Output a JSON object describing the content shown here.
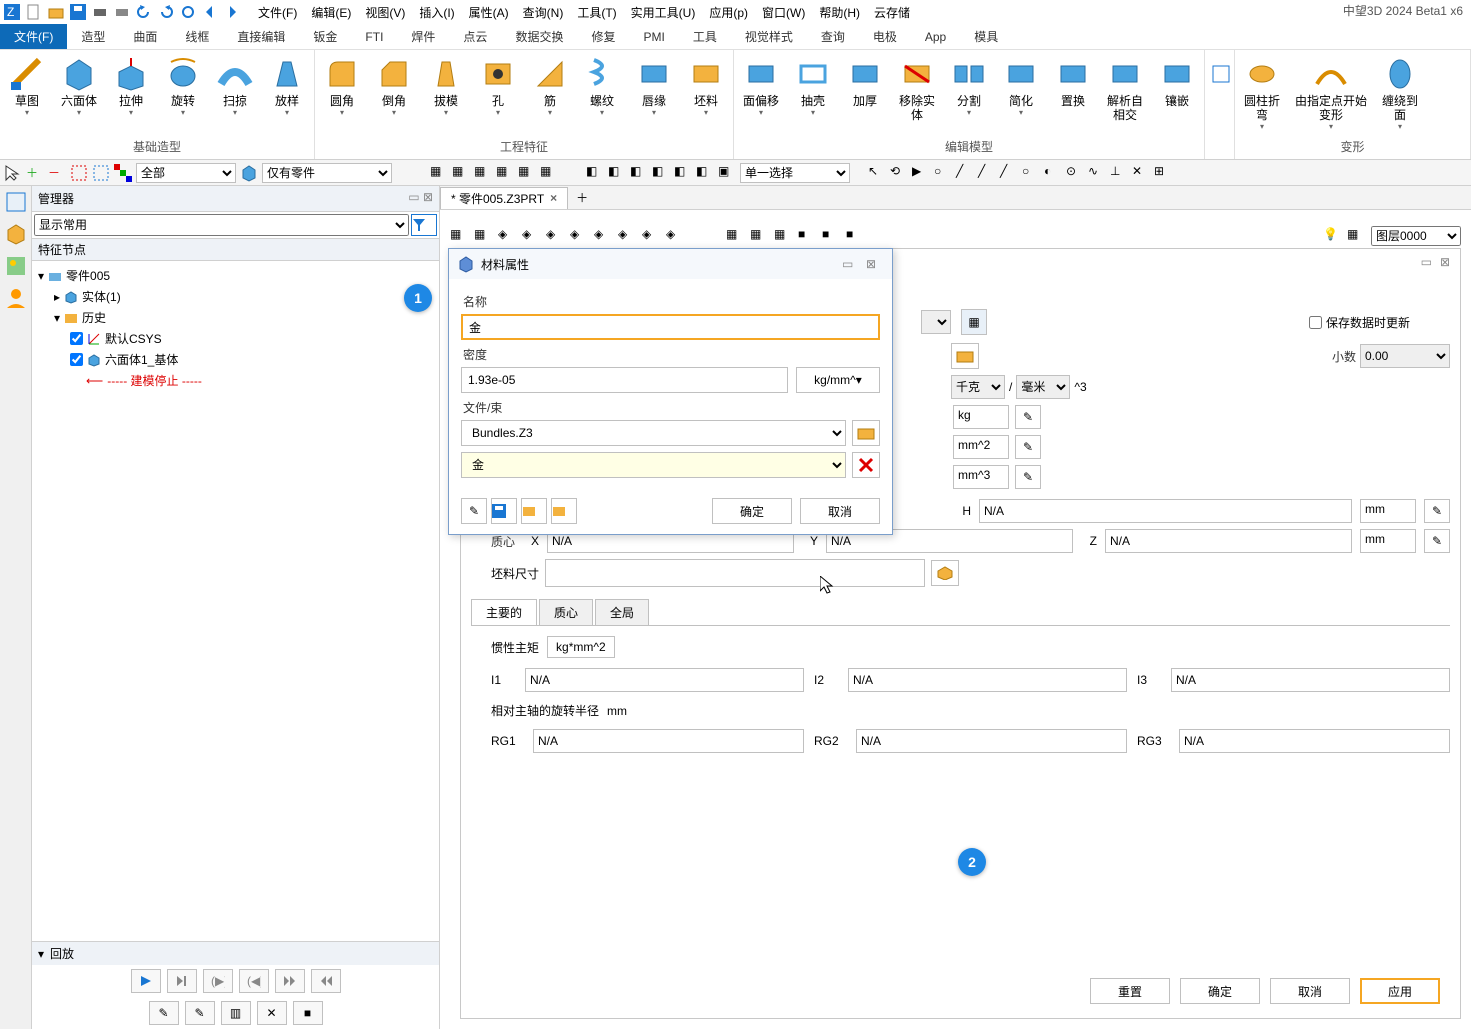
{
  "app_title": "中望3D 2024 Beta1 x6",
  "menus": [
    "文件(F)",
    "编辑(E)",
    "视图(V)",
    "插入(I)",
    "属性(A)",
    "查询(N)",
    "工具(T)",
    "实用工具(U)",
    "应用(p)",
    "窗口(W)",
    "帮助(H)",
    "云存储"
  ],
  "ribbon_tabs": [
    "文件(F)",
    "造型",
    "曲面",
    "线框",
    "直接编辑",
    "钣金",
    "FTI",
    "焊件",
    "点云",
    "数据交换",
    "修复",
    "PMI",
    "工具",
    "视觉样式",
    "查询",
    "电极",
    "App",
    "模具"
  ],
  "ribbon_active_tab": "造型",
  "ribbon_groups": {
    "base": {
      "label": "基础造型",
      "items": [
        "草图",
        "六面体",
        "拉伸",
        "旋转",
        "扫掠",
        "放样"
      ]
    },
    "feature": {
      "label": "工程特征",
      "items": [
        "圆角",
        "倒角",
        "拔模",
        "孔",
        "筋",
        "螺纹",
        "唇缘",
        "坯料"
      ]
    },
    "edit": {
      "label": "编辑模型",
      "items": [
        "面偏移",
        "抽壳",
        "加厚",
        "移除实体",
        "分割",
        "简化",
        "置换",
        "解析自相交",
        "镶嵌"
      ]
    },
    "deform_anchor": {
      "label": "",
      "items": [
        ""
      ]
    },
    "deform": {
      "label": "变形",
      "items": [
        "圆柱折弯",
        "由指定点开始变形",
        "缠绕到面"
      ]
    }
  },
  "filter_bar": {
    "all": "全部",
    "parts_only": "仅有零件",
    "select_mode": "单一选择"
  },
  "doc_tab": {
    "name": "* 零件005.Z3PRT"
  },
  "manager": {
    "title": "管理器",
    "filter": "显示常用",
    "tree_header": "特征节点",
    "root": "零件005",
    "entity": "实体(1)",
    "history": "历史",
    "csys": "默认CSYS",
    "box": "六面体1_基体",
    "stop": "----- 建模停止 -----",
    "playback": "回放"
  },
  "modal": {
    "title": "材料属性",
    "name_label": "名称",
    "name_value": "金",
    "density_label": "密度",
    "density_value": "1.93e-05",
    "density_unit": "kg/mm^",
    "file_label": "文件/束",
    "file_value": "Bundles.Z3",
    "material_value": "金",
    "ok": "确定",
    "cancel": "取消"
  },
  "right_panel": {
    "save_data": "保存数据时更新",
    "decimal_label": "小数",
    "decimal_value": "0.00",
    "mass_unit": "千克",
    "length_unit": "毫米",
    "cube": "^3",
    "kg": "kg",
    "mm2": "mm^2",
    "mm3": "mm^3",
    "H": "H",
    "mm": "mm",
    "NA": "N/A",
    "centroid_label": "质心",
    "X": "X",
    "Y": "Y",
    "Z": "Z",
    "stock_label": "坯料尺寸",
    "tabs": [
      "主要的",
      "质心",
      "全局"
    ],
    "inertia_label": "惯性主矩",
    "inertia_unit": "kg*mm^2",
    "I1": "I1",
    "I2": "I2",
    "I3": "I3",
    "radius_label": "相对主轴的旋转半径",
    "RG1": "RG1",
    "RG2": "RG2",
    "RG3": "RG3",
    "reset": "重置",
    "ok": "确定",
    "cancel": "取消",
    "apply": "应用"
  },
  "layer": "图层0000",
  "badges": {
    "b1": "1",
    "b2": "2"
  }
}
